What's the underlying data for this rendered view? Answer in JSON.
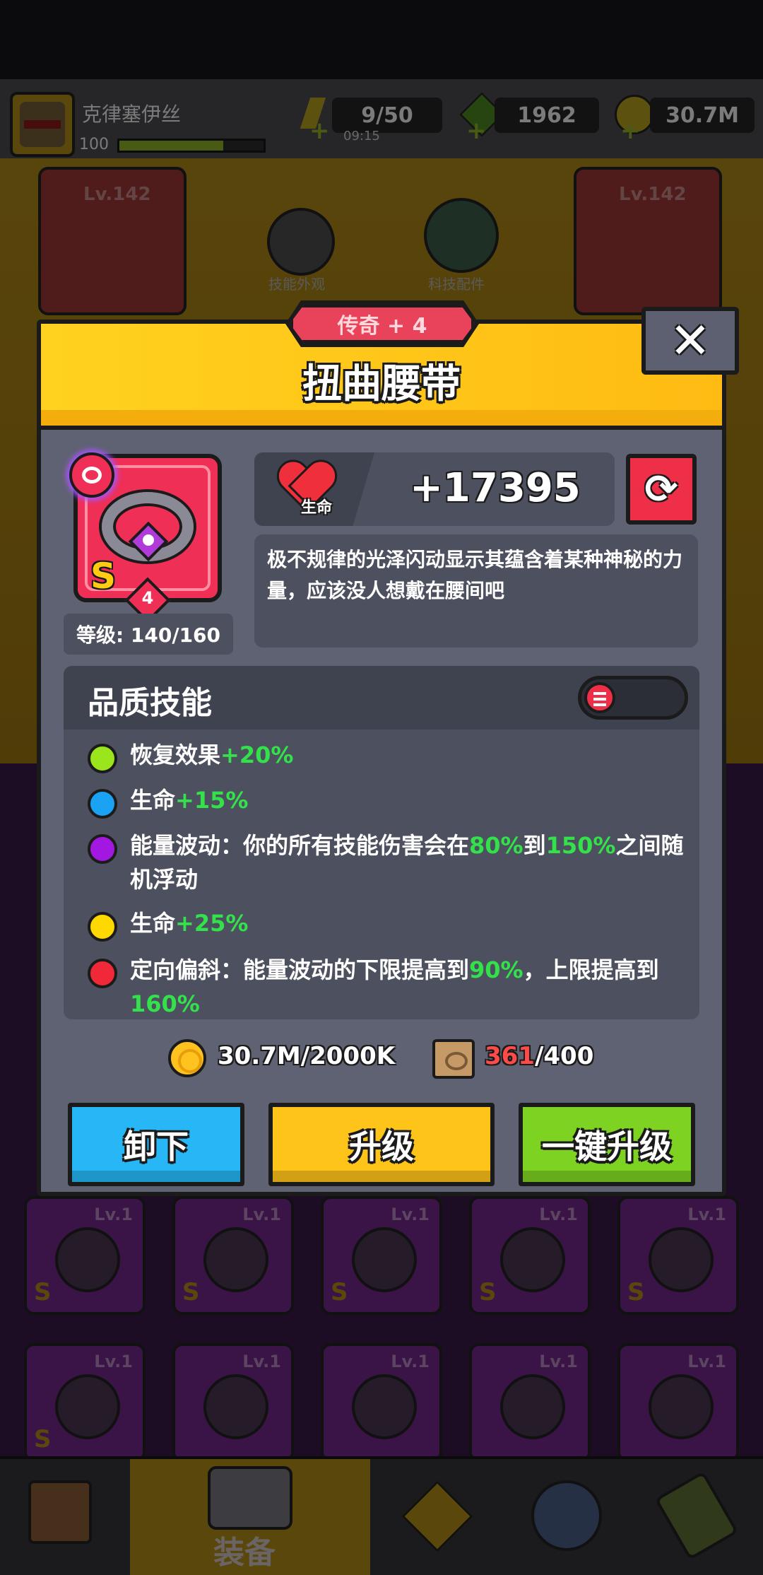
{
  "player": {
    "name": "克律塞伊丝",
    "level": "100",
    "xp_fraction": 0.72
  },
  "resources": {
    "energy": "9/50",
    "energy_timer": "09:15",
    "gems": "1962",
    "coins": "30.7M"
  },
  "background": {
    "weapon_level": "Lv.142",
    "armor_level": "Lv.142",
    "skill_skin_label": "技能外观",
    "tech_parts_label": "科技配件",
    "slot_badge": "4",
    "grade": "S",
    "inventory_items": [
      {
        "level": "Lv.1",
        "grade": "S"
      },
      {
        "level": "Lv.1",
        "grade": "S"
      },
      {
        "level": "Lv.1",
        "grade": "S"
      },
      {
        "level": "Lv.1",
        "grade": "S"
      },
      {
        "level": "Lv.1",
        "grade": "S"
      },
      {
        "level": "Lv.1",
        "grade": "S"
      },
      {
        "level": "Lv.1",
        "grade": ""
      },
      {
        "level": "Lv.1",
        "grade": ""
      },
      {
        "level": "Lv.1",
        "grade": ""
      },
      {
        "level": "Lv.1",
        "grade": ""
      }
    ],
    "nav_active_label": "装备"
  },
  "modal": {
    "rarity": "传奇 + 4",
    "title": "扭曲腰带",
    "close_symbol": "✕",
    "item_grade": "S",
    "item_stars": "4",
    "level_text": "等级: 140/160",
    "stat_label": "生命",
    "stat_value": "+17395",
    "refresh_symbol": "⟳",
    "description": "极不规律的光泽闪动显示其蕴含着某种神秘的力量，应该没人想戴在腰间吧",
    "skills_title": "品质技能",
    "skills": [
      {
        "color": "#9be51c",
        "name": "恢复效果",
        "bonus": "+20%"
      },
      {
        "color": "#1aa3f2",
        "name": "生命",
        "bonus": "+15%"
      },
      {
        "color": "#a218e0",
        "prefix": "能量波动：你的所有技能伤害会在",
        "v1": "80%",
        "mid": "到",
        "v2": "150%",
        "suffix": "之间随机浮动"
      },
      {
        "color": "#ffd800",
        "name": "生命",
        "bonus": "+25%"
      },
      {
        "color": "#f02838",
        "prefix": "定向偏斜：能量波动的下限提高到",
        "v1": "90%",
        "mid": "，上限提高到",
        "v2": "160%",
        "suffix": ""
      }
    ],
    "gold_cost": "30.7M/2000K",
    "scroll_have": "361",
    "scroll_need": "/400",
    "unequip_label": "卸下",
    "upgrade_label": "升级",
    "upgrade_all_label": "一键升级"
  },
  "colors": {
    "header_yellow": "#ffd21f",
    "panel": "#5f6272",
    "legend_red": "#ef2f56",
    "highlight_green": "#33e24a"
  }
}
